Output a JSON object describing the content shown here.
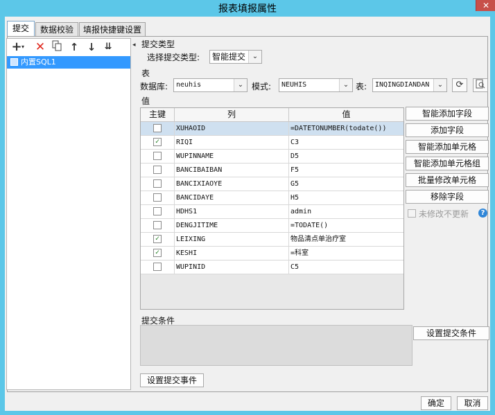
{
  "window": {
    "title": "报表填报属性",
    "close_label": "✕"
  },
  "tabs": [
    {
      "label": "提交"
    },
    {
      "label": "数据校验"
    },
    {
      "label": "填报快捷键设置"
    }
  ],
  "toolbar": {
    "icons": [
      "add-icon",
      "delete-icon",
      "copy-icon",
      "move-up-icon",
      "move-down-icon",
      "move-bottom-icon"
    ]
  },
  "sql_list": [
    {
      "label": "内置SQL1"
    }
  ],
  "submit_type": {
    "section_label": "提交类型",
    "select_label": "选择提交类型:",
    "value": "智能提交"
  },
  "table_section": {
    "section_label": "表",
    "db_label": "数据库:",
    "db_value": "neuhis",
    "schema_label": "模式:",
    "schema_value": "NEUHIS",
    "table_label": "表:",
    "table_value": "INQINGDIANDAN"
  },
  "value_section": {
    "section_label": "值",
    "columns": [
      "主键",
      "列",
      "值"
    ],
    "rows": [
      {
        "key": false,
        "column": "XUHAOID",
        "value": "=DATETONUMBER(todate())"
      },
      {
        "key": true,
        "column": "RIQI",
        "value": "C3"
      },
      {
        "key": false,
        "column": "WUPINNAME",
        "value": "D5"
      },
      {
        "key": false,
        "column": "BANCIBAIBAN",
        "value": "F5"
      },
      {
        "key": false,
        "column": "BANCIXIAOYE",
        "value": "G5"
      },
      {
        "key": false,
        "column": "BANCIDAYE",
        "value": "H5"
      },
      {
        "key": false,
        "column": "HDHS1",
        "value": "admin"
      },
      {
        "key": false,
        "column": "DENGJITIME",
        "value": "=TODATE()"
      },
      {
        "key": true,
        "column": "LEIXING",
        "value": "物品清点单治疗室"
      },
      {
        "key": true,
        "column": "KESHI",
        "value": "=科室"
      },
      {
        "key": false,
        "column": "WUPINID",
        "value": "C5"
      }
    ]
  },
  "field_buttons": {
    "smart_add_field": "智能添加字段",
    "add_field": "添加字段",
    "smart_add_cell": "智能添加单元格",
    "smart_add_cell_group": "智能添加单元格组",
    "batch_modify_cell": "批量修改单元格",
    "remove_field": "移除字段",
    "no_update_unmodified": "未修改不更新"
  },
  "condition_section": {
    "section_label": "提交条件",
    "set_condition_button": "设置提交条件"
  },
  "event_button": "设置提交事件",
  "footer": {
    "ok": "确定",
    "cancel": "取消"
  },
  "colors": {
    "titlebar": "#5cc7e8",
    "selection": "#3399ff",
    "close": "#c7504a",
    "help": "#2f86d8"
  }
}
